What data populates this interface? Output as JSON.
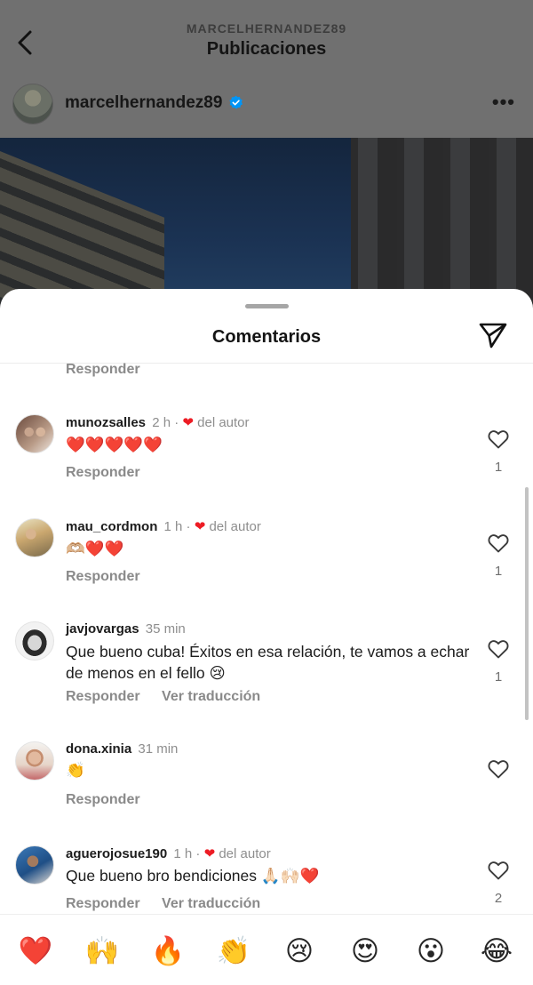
{
  "header": {
    "username": "MARCELHERNANDEZ89",
    "title": "Publicaciones"
  },
  "post": {
    "username": "marcelhernandez89",
    "more": "•••"
  },
  "sheet": {
    "title": "Comentarios"
  },
  "reply_label": "Responder",
  "translate_label": "Ver traducción",
  "author_label": "del autor",
  "comments": [
    {
      "username": "munozsalles",
      "time": "2 h · ",
      "liked_by_author": true,
      "text": "❤️❤️❤️❤️❤️",
      "likes": "1",
      "translate": false
    },
    {
      "username": "mau_cordmon",
      "time": "1 h · ",
      "liked_by_author": true,
      "text": "🫶🏼❤️❤️",
      "likes": "1",
      "translate": false
    },
    {
      "username": "javjovargas",
      "time": "35 min",
      "liked_by_author": false,
      "text": "Que bueno cuba! Éxitos en esa relación, te vamos a echar de menos en el fello 😢",
      "likes": "1",
      "translate": true
    },
    {
      "username": "dona.xinia",
      "time": "31 min",
      "liked_by_author": false,
      "text": "👏",
      "likes": "",
      "translate": false
    },
    {
      "username": "aguerojosue190",
      "time": "1 h · ",
      "liked_by_author": true,
      "text": "Que bueno bro bendiciones 🙏🏻🙌🏻❤️",
      "likes": "2",
      "translate": true
    }
  ],
  "quick_reactions": [
    "❤️",
    "🙌",
    "🔥",
    "👏",
    "😢",
    "😍",
    "😮",
    "😂"
  ],
  "colors": {
    "like_red": "#ed1c24",
    "verified_blue": "#0095f6",
    "secondary_text": "#8e8e8e"
  }
}
